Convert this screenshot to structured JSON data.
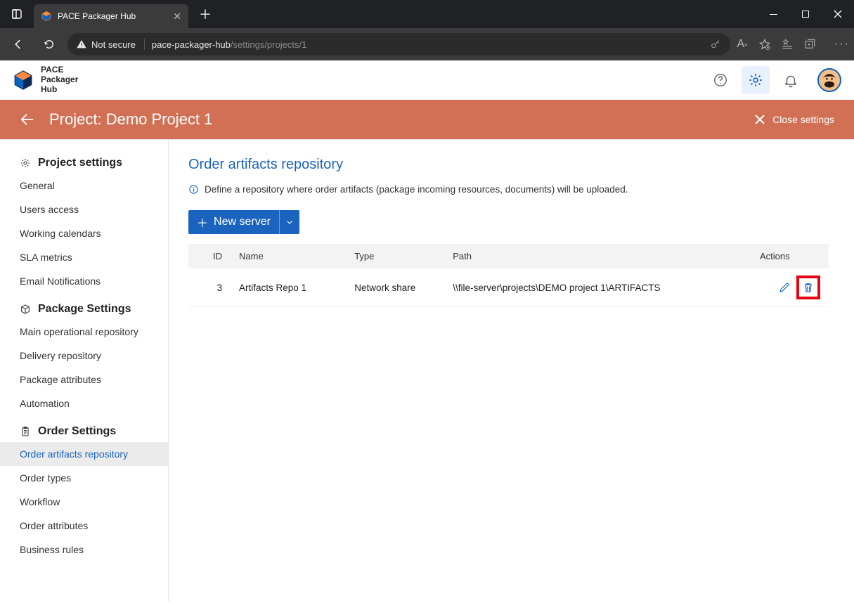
{
  "browser": {
    "tab_title": "PACE Packager Hub",
    "not_secure_label": "Not secure",
    "url_host": "pace-packager-hub",
    "url_path": "/settings/projects/1"
  },
  "app": {
    "product_line1": "PACE",
    "product_line2": "Packager",
    "product_line3": "Hub"
  },
  "projectbar": {
    "title": "Project: Demo Project 1",
    "close_label": "Close settings"
  },
  "sidebar": {
    "sections": [
      {
        "heading": "Project settings",
        "items": [
          "General",
          "Users access",
          "Working calendars",
          "SLA metrics",
          "Email Notifications"
        ]
      },
      {
        "heading": "Package Settings",
        "items": [
          "Main operational repository",
          "Delivery repository",
          "Package attributes",
          "Automation"
        ]
      },
      {
        "heading": "Order Settings",
        "items": [
          "Order artifacts repository",
          "Order types",
          "Workflow",
          "Order attributes",
          "Business rules"
        ]
      }
    ],
    "active": "Order artifacts repository"
  },
  "page": {
    "title": "Order artifacts repository",
    "info": "Define a repository where order artifacts (package incoming resources, documents) will be uploaded.",
    "new_server_label": "New server",
    "table": {
      "headers": {
        "id": "ID",
        "name": "Name",
        "type": "Type",
        "path": "Path",
        "actions": "Actions"
      },
      "rows": [
        {
          "id": "3",
          "name": "Artifacts Repo 1",
          "type": "Network share",
          "path": "\\\\file-server\\projects\\DEMO project 1\\ARTIFACTS"
        }
      ]
    }
  }
}
